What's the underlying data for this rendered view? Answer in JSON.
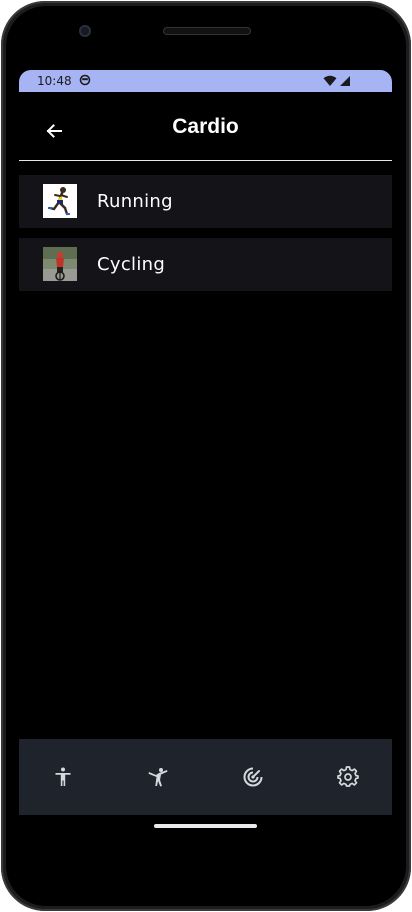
{
  "status_bar": {
    "time": "10:48",
    "background_color": "#a7b4f3",
    "icons": [
      "app-notification-icon",
      "wifi-icon",
      "cellular-signal-icon"
    ]
  },
  "app_bar": {
    "title": "Cardio",
    "back_icon": "arrow-back-icon"
  },
  "exercises": [
    {
      "label": "Running",
      "thumbnail": "runner-photo"
    },
    {
      "label": "Cycling",
      "thumbnail": "cyclist-photo"
    }
  ],
  "bottom_nav": {
    "items": [
      {
        "icon": "person-standing-icon"
      },
      {
        "icon": "martial-arts-icon"
      },
      {
        "icon": "radar-target-icon"
      },
      {
        "icon": "settings-gear-icon"
      }
    ],
    "background_color": "#1f232b"
  },
  "colors": {
    "screen_background": "#000000",
    "list_item_background": "#131318",
    "text": "#ffffff"
  }
}
